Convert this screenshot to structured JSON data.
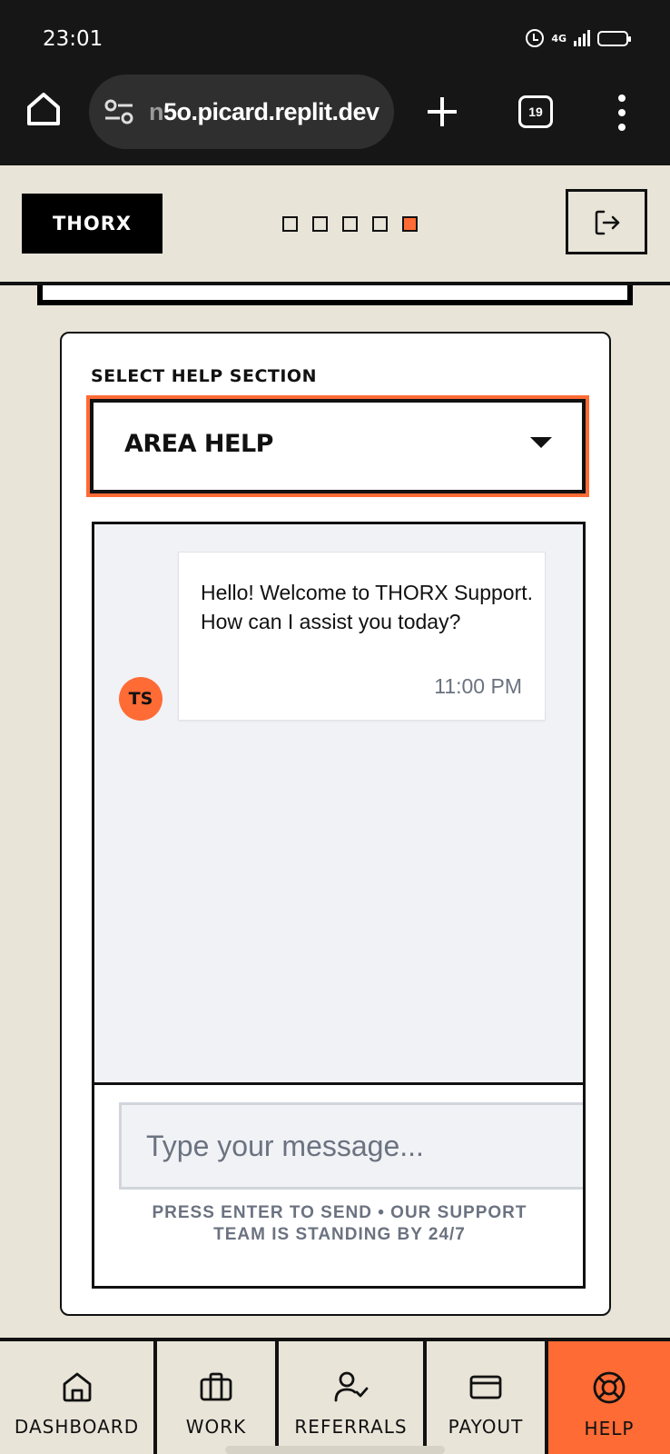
{
  "status_bar": {
    "time": "23:01",
    "network": "4G",
    "icons": [
      "alarm-icon",
      "signal-icon",
      "battery-icon"
    ],
    "battery_color": "#f5c518"
  },
  "browser": {
    "url_faded": "n",
    "url": "5o.picard.replit.dev",
    "tab_count": "19",
    "icons": [
      "home-icon",
      "tune-icon",
      "plus-icon",
      "tabs-icon",
      "more-vert-icon"
    ]
  },
  "header": {
    "logo": "THORX",
    "progress_steps": 5,
    "active_step": 5,
    "logout_icon": "logout-icon"
  },
  "help": {
    "section_label": "SELECT HELP SECTION",
    "selected_section": "AREA HELP",
    "messages": [
      {
        "avatar": "TS",
        "text": "Hello! Welcome to THORX Support. How can I assist you today?",
        "time": "11:00 PM"
      }
    ],
    "input_placeholder": "Type your message...",
    "hint_line1": "PRESS ENTER TO SEND • OUR SUPPORT",
    "hint_line2": "TEAM IS STANDING BY 24/7"
  },
  "nav": {
    "items": [
      {
        "label": "DASHBOARD",
        "icon": "home-icon"
      },
      {
        "label": "WORK",
        "icon": "briefcase-icon"
      },
      {
        "label": "REFERRALS",
        "icon": "user-check-icon"
      },
      {
        "label": "PAYOUT",
        "icon": "credit-card-icon"
      },
      {
        "label": "HELP",
        "icon": "lifebuoy-icon"
      }
    ],
    "active": "HELP"
  },
  "colors": {
    "accent": "#ff6b35",
    "background": "#e8e4d8",
    "chat_background": "#f0f2f5",
    "muted_text": "#6b7280"
  }
}
